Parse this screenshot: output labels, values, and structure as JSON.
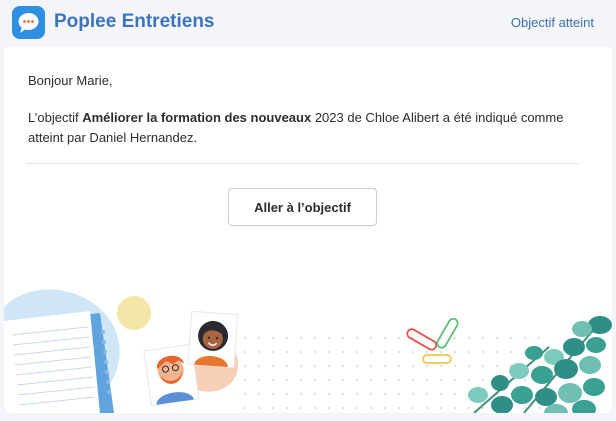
{
  "header": {
    "app_icon": "chat-bubble-icon",
    "brand": "Poplee Entretiens",
    "status_link": "Objectif atteint",
    "accent": "#3b74c2"
  },
  "email": {
    "greeting": "Bonjour Marie,",
    "intro": "L’objectif ",
    "objective": "Améliorer la formation des nouveaux",
    "rest_line": " 2023 de Chloe Alibert a été indiqué comme atteint par Daniel Hernandez.",
    "cta_label": "Aller à l’objectif"
  },
  "illustration": {
    "elements": [
      "notebook",
      "avatar-photo-man",
      "avatar-photo-woman",
      "paper-clips",
      "leaves"
    ]
  }
}
